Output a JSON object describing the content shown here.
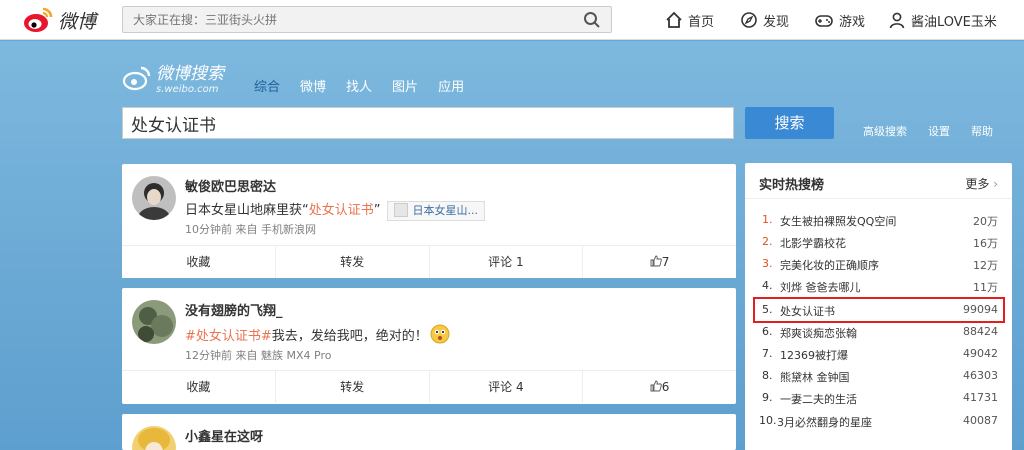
{
  "topbar": {
    "logo_text": "微博",
    "search_placeholder": "大家正在搜：三亚街头火拼",
    "nav": [
      "首页",
      "发现",
      "游戏",
      "酱油LOVE玉米"
    ]
  },
  "search_page": {
    "logo_title": "微博搜索",
    "logo_sub": "s.weibo.com",
    "tabs": [
      "综合",
      "微博",
      "找人",
      "图片",
      "应用"
    ],
    "query": "处女认证书",
    "search_button": "搜索",
    "links": [
      "高级搜索",
      "设置",
      "帮助"
    ]
  },
  "posts": [
    {
      "name": "敏俊欧巴思密达",
      "text_before": "日本女星山地麻里获“",
      "highlight": "处女认证书",
      "text_after": "”",
      "tag": "日本女星山...",
      "meta": "10分钟前 来自 手机新浪网",
      "actions": [
        "收藏",
        "转发",
        "评论 1",
        "7"
      ]
    },
    {
      "name": "没有翅膀的飞翔_",
      "hashtag": "#处女认证书#",
      "text_after": "我去，发给我吧，绝对的！",
      "meta": "12分钟前 来自 魅族 MX4 Pro",
      "actions": [
        "收藏",
        "转发",
        "评论 4",
        "6"
      ]
    },
    {
      "name": "小鑫星在这呀"
    }
  ],
  "hot": {
    "title": "实时热搜榜",
    "more": "更多",
    "items": [
      {
        "rank": "1.",
        "keyword": "女生被拍裸照发QQ空间",
        "count": "20万"
      },
      {
        "rank": "2.",
        "keyword": "北影学霸校花",
        "count": "16万"
      },
      {
        "rank": "3.",
        "keyword": "完美化妆的正确顺序",
        "count": "12万"
      },
      {
        "rank": "4.",
        "keyword": "刘烨 爸爸去哪儿",
        "count": "11万"
      },
      {
        "rank": "5.",
        "keyword": "处女认证书",
        "count": "99094"
      },
      {
        "rank": "6.",
        "keyword": "郑爽谈痴恋张翰",
        "count": "88424"
      },
      {
        "rank": "7.",
        "keyword": "12369被打爆",
        "count": "49042"
      },
      {
        "rank": "8.",
        "keyword": "熊黛林 金钟国",
        "count": "46303"
      },
      {
        "rank": "9.",
        "keyword": "一妻二夫的生活",
        "count": "41731"
      },
      {
        "rank": "10.",
        "keyword": "3月必然翻身的星座",
        "count": "40087"
      }
    ]
  },
  "colors": {
    "accent": "#3a89d4",
    "highlight": "#eb7350",
    "rank_top3": "#e6501e",
    "box": "#e02020"
  }
}
